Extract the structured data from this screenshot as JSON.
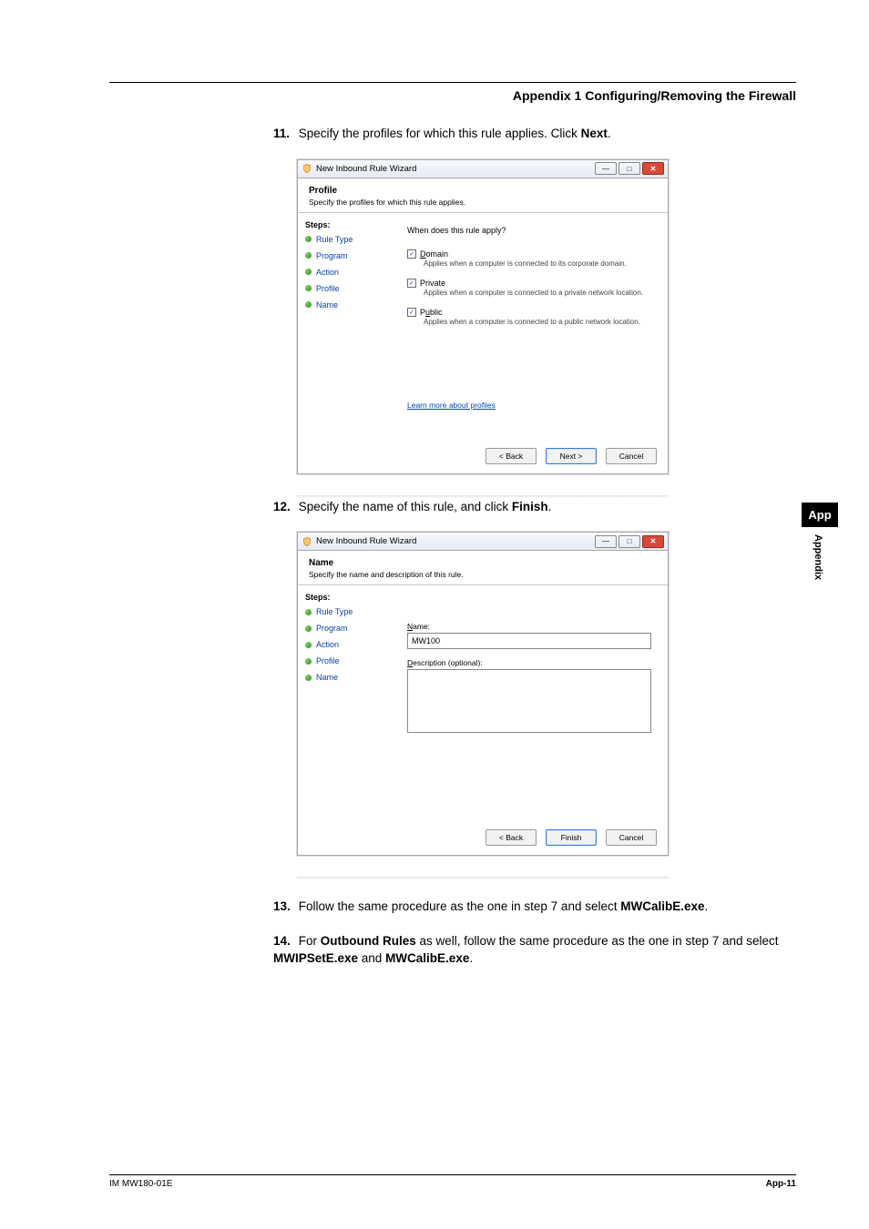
{
  "header": {
    "title": "Appendix 1  Configuring/Removing the Firewall"
  },
  "side": {
    "app": "App",
    "appendix": "Appendix"
  },
  "footer": {
    "left": "IM MW180-01E",
    "right": "App-11"
  },
  "steps": {
    "s11": {
      "num": "11.",
      "text_a": "Specify the profiles for which this rule applies. Click ",
      "bold": "Next",
      "text_b": "."
    },
    "s12": {
      "num": "12.",
      "text_a": "Specify the name of this rule, and click ",
      "bold": "Finish",
      "text_b": "."
    },
    "s13": {
      "num": "13.",
      "text_a": "Follow the same procedure as the one in step 7 and select ",
      "bold": "MWCalibE.exe",
      "text_b": "."
    },
    "s14": {
      "num": "14.",
      "text_a": "For ",
      "bold1": "Outbound Rules",
      "text_b": " as well, follow the same procedure as the one in step 7 and select ",
      "bold2": "MWIPSetE.exe",
      "text_c": " and ",
      "bold3": "MWCalibE.exe",
      "text_d": "."
    }
  },
  "wizard": {
    "title": "New Inbound Rule Wizard",
    "steps_header": "Steps:",
    "step_items": [
      "Rule Type",
      "Program",
      "Action",
      "Profile",
      "Name"
    ],
    "buttons": {
      "back": "< Back",
      "next": "Next >",
      "finish": "Finish",
      "cancel": "Cancel"
    }
  },
  "dlg_profile": {
    "name": "Profile",
    "desc": "Specify the profiles for which this rule applies.",
    "question": "When does this rule apply?",
    "opts": [
      {
        "label_u": "D",
        "label_rest": "omain",
        "desc": "Applies when a computer is connected to its corporate domain."
      },
      {
        "label_plain": "Private",
        "desc": "Applies when a computer is connected to a private network location."
      },
      {
        "label_u": "P",
        "label_rest_pre": "",
        "label_plain_u": "u",
        "label_rest": "blic",
        "full": "Public",
        "desc": "Applies when a computer is connected to a public network location."
      }
    ],
    "learn": "Learn more about profiles"
  },
  "dlg_name": {
    "name": "Name",
    "desc": "Specify the name and description of this rule.",
    "name_label_u": "N",
    "name_label_rest": "ame:",
    "name_value": "MW100",
    "desc_label_u": "D",
    "desc_label_rest": "escription (optional):"
  }
}
